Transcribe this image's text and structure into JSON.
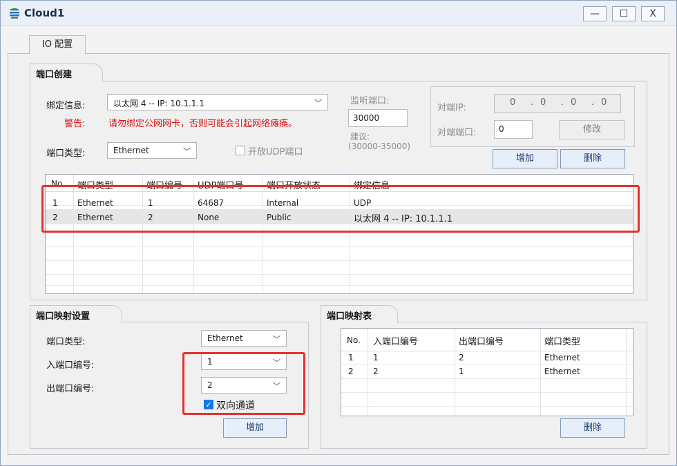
{
  "window": {
    "title": "Cloud1",
    "minimize": "—",
    "maximize": "☐",
    "close": "X"
  },
  "tab": {
    "label": "IO 配置"
  },
  "port_create": {
    "group_title": "端口创建",
    "bind_label": "绑定信息:",
    "bind_value": "以太网 4 -- IP: 10.1.1.1",
    "warning_label": "警告:",
    "warning_text": "请勿绑定公网网卡，否则可能会引起网络瘫痪。",
    "port_type_label": "端口类型:",
    "port_type_value": "Ethernet",
    "open_udp_label": "开放UDP端口",
    "listen_port_label": "监听端口:",
    "listen_port_value": "30000",
    "suggest_label": "建议:",
    "suggest_range": "(30000-35000)",
    "peer_ip_label": "对端IP:",
    "peer_ip_octets": [
      "0",
      "0",
      "0",
      "0"
    ],
    "peer_port_label": "对端端口:",
    "peer_port_value": "0",
    "modify_button": "修改",
    "add_button": "增加",
    "delete_button": "删除",
    "table": {
      "headers": [
        "No.",
        "端口类型",
        "端口编号",
        "UDP端口号",
        "端口开放状态",
        "绑定信息"
      ],
      "rows": [
        [
          "1",
          "Ethernet",
          "1",
          "64687",
          "Internal",
          "UDP"
        ],
        [
          "2",
          "Ethernet",
          "2",
          "None",
          "Public",
          "以太网 4 -- IP: 10.1.1.1"
        ]
      ]
    }
  },
  "port_mapping": {
    "group_title": "端口映射设置",
    "port_type_label": "端口类型:",
    "port_type_value": "Ethernet",
    "in_port_label": "入端口编号:",
    "in_port_value": "1",
    "out_port_label": "出端口编号:",
    "out_port_value": "2",
    "bidirectional_label": "双向通道",
    "add_button": "增加"
  },
  "mapping_table": {
    "group_title": "端口映射表",
    "headers": [
      "No.",
      "入端口编号",
      "出端口编号",
      "端口类型"
    ],
    "rows": [
      [
        "1",
        "1",
        "2",
        "Ethernet"
      ],
      [
        "2",
        "2",
        "1",
        "Ethernet"
      ]
    ],
    "delete_button": "删除"
  },
  "colors": {
    "highlight_box": "#e53030",
    "warning_text": "#e01010",
    "checkbox_accent": "#1677e5"
  }
}
